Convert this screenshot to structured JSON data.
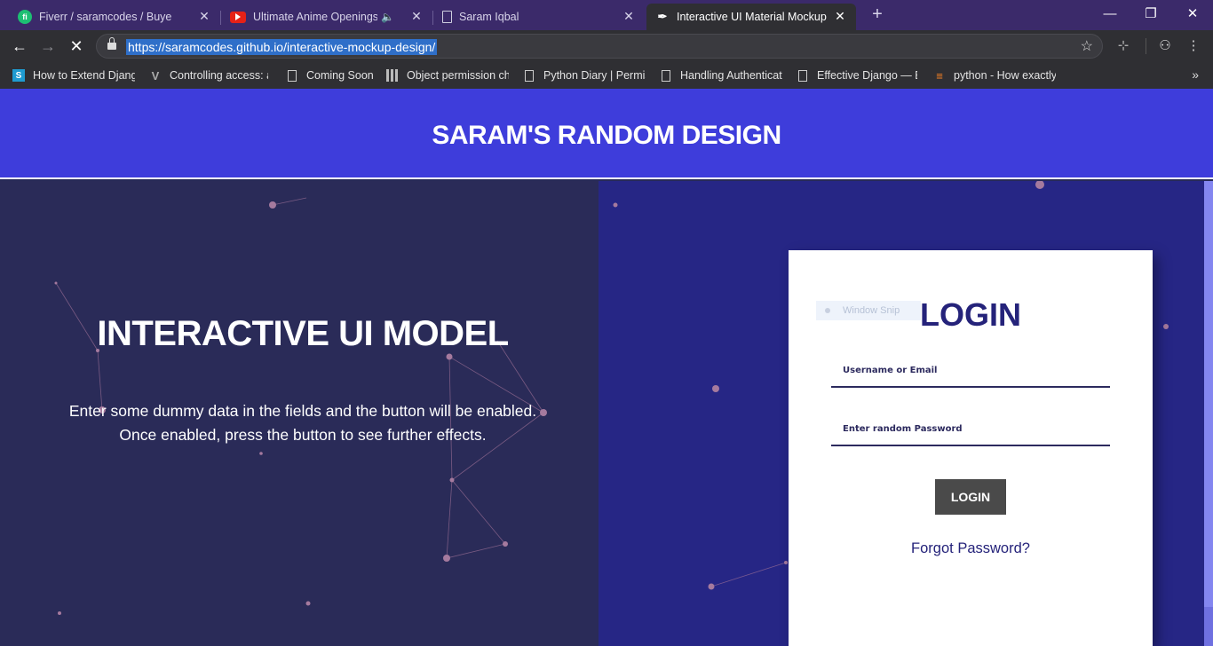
{
  "browser": {
    "tabs": [
      {
        "title": "Fiverr / saramcodes / Buyer Requ",
        "icon": "fiverr-icon"
      },
      {
        "title": "Ultimate Anime Openings +",
        "icon": "youtube-icon"
      },
      {
        "title": "Saram Iqbal",
        "icon": "document-icon"
      },
      {
        "title": "Interactive UI Material Mockup",
        "icon": "feather-icon",
        "active": true
      }
    ],
    "url": "https://saramcodes.github.io/interactive-mockup-design/",
    "bookmarks": [
      {
        "label": "How to Extend Djang",
        "icon": "s-icon"
      },
      {
        "label": "Controlling access: a",
        "icon": "v-icon"
      },
      {
        "label": "Coming Soon",
        "icon": "document-icon"
      },
      {
        "label": "Object permission ch",
        "icon": "grid-icon"
      },
      {
        "label": "Python Diary | Permis",
        "icon": "document-icon"
      },
      {
        "label": "Handling Authenticat",
        "icon": "document-icon"
      },
      {
        "label": "Effective Django — E",
        "icon": "document-icon"
      },
      {
        "label": "python - How exactly",
        "icon": "stackoverflow-icon"
      }
    ]
  },
  "page": {
    "header_title": "SARAM'S RANDOM DESIGN",
    "hero_title": "INTERACTIVE UI MODEL",
    "hero_text_line1": "Enter some dummy data in the fields and the button will be enabled.",
    "hero_text_line2": "Once enabled, press the button to see further effects.",
    "login": {
      "overlay_label": "Window Snip",
      "title": "LOGIN",
      "username_placeholder": "Username or Email",
      "password_placeholder": "Enter random Password",
      "button_label": "LOGIN",
      "forgot_label": "Forgot Password?"
    }
  },
  "colors": {
    "header": "#3e3ddb",
    "left_panel": "#2a2b58",
    "right_panel": "#262685",
    "accent_text": "#25237a",
    "button": "#4a4a4a"
  }
}
